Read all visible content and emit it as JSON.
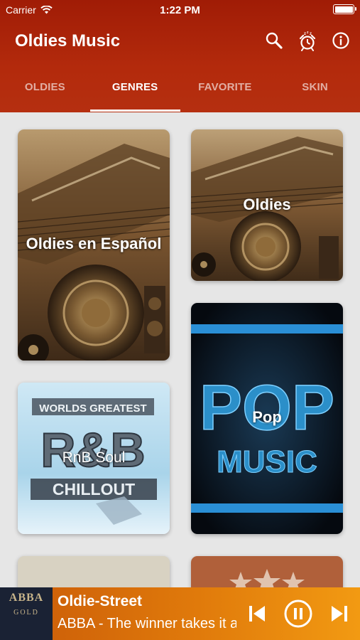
{
  "status_bar": {
    "carrier": "Carrier",
    "time": "1:22 PM"
  },
  "header": {
    "title": "Oldies Music",
    "icons": [
      "search-icon",
      "sleep-alarm-icon",
      "info-icon"
    ]
  },
  "tabs": [
    {
      "label": "OLDIES",
      "active": false
    },
    {
      "label": "GENRES",
      "active": true
    },
    {
      "label": "FAVORITE",
      "active": false
    },
    {
      "label": "SKIN",
      "active": false
    }
  ],
  "genres": [
    {
      "label": "Oldies en Español"
    },
    {
      "label": "Oldies"
    },
    {
      "label": "RnB Soul",
      "art_lines": [
        "WORLDS GREATEST",
        "R&B",
        "CHILLOUT"
      ]
    },
    {
      "label": "Pop",
      "art_lines": [
        "POP",
        "MUSIC"
      ]
    }
  ],
  "player": {
    "album_art": {
      "line1": "ABBA",
      "line2": "GOLD"
    },
    "title": "Oldie-Street",
    "subtitle": "ABBA - The winner takes it all",
    "controls": [
      "previous-icon",
      "pause-icon",
      "next-icon"
    ]
  },
  "colors": {
    "header": "#a81f08",
    "player_start": "#c95a08",
    "player_end": "#f29a12",
    "background": "#e6e6e6"
  }
}
